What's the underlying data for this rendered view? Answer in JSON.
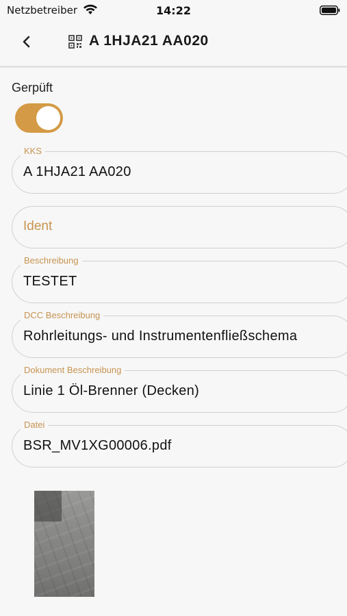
{
  "status_bar": {
    "carrier": "Netzbetreiber",
    "time": "14:22"
  },
  "header": {
    "title": "A 1HJA21 AA020"
  },
  "toggle": {
    "label": "Gerpüft",
    "on": true,
    "accent_color": "#d49a45"
  },
  "fields": {
    "kks": {
      "label": "KKS",
      "value": "A 1HJA21 AA020"
    },
    "ident": {
      "placeholder": "Ident",
      "value": ""
    },
    "beschreibung": {
      "label": "Beschreibung",
      "value": "TESTET"
    },
    "dcc_beschreibung": {
      "label": "DCC Beschreibung",
      "value": "Rohrleitungs- und Instrumentenfließschema"
    },
    "dokument_beschreibung": {
      "label": "Dokument Beschreibung",
      "value": "Linie 1 Öl-Brenner (Decken)"
    },
    "datei": {
      "label": "Datei",
      "value": "BSR_MV1XG00006.pdf"
    }
  },
  "colors": {
    "accent": "#c79350",
    "background": "#f7f7f7"
  }
}
